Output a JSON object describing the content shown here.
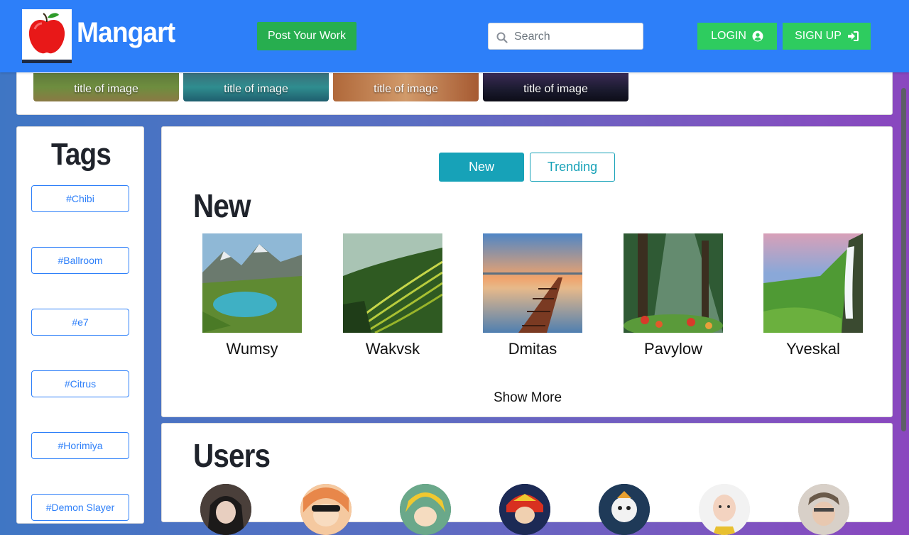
{
  "header": {
    "brand": "Mangart",
    "post_button": "Post Your Work",
    "search_placeholder": "Search",
    "login_label": "LOGIN",
    "signup_label": "SIGN UP",
    "logo_icon": "apple-icon",
    "colors": {
      "navbar": "#2d7ff9",
      "accent_green": "#2ecc5f"
    }
  },
  "carousel": {
    "items": [
      {
        "caption": "title of image"
      },
      {
        "caption": "title of image"
      },
      {
        "caption": "title of image"
      },
      {
        "caption": "title of image"
      }
    ]
  },
  "tags": {
    "title": "Tags",
    "items": [
      "#Chibi",
      "#Ballroom",
      "#e7",
      "#Citrus",
      "#Horimiya",
      "#Demon Slayer"
    ]
  },
  "main": {
    "tabs": {
      "new": "New",
      "trending": "Trending"
    },
    "section_title": "New",
    "artworks": [
      {
        "name": "Wumsy"
      },
      {
        "name": "Wakvsk"
      },
      {
        "name": "Dmitas"
      },
      {
        "name": "Pavylow"
      },
      {
        "name": "Yveskal"
      }
    ],
    "show_more": "Show More",
    "accent": "#17a2b8"
  },
  "users": {
    "title": "Users",
    "count_visible": 7
  }
}
